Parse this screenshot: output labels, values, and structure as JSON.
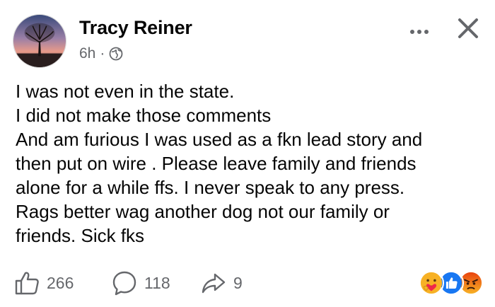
{
  "post": {
    "author": "Tracy Reiner",
    "time": "6h",
    "separator": "·",
    "privacy_icon": "globe-icon",
    "body_lines": [
      "I was not even in the state.",
      "I did not make those comments",
      "And am furious I was used as a fkn lead story and",
      "then put on wire . Please leave family and friends",
      "alone for a while ffs. I never speak to any press.",
      "Rags better wag another dog not our family or",
      "friends. Sick fks"
    ]
  },
  "actions": {
    "like_count": "266",
    "comment_count": "118",
    "share_count": "9"
  },
  "reactions": [
    "care-emoji-icon",
    "like-emoji-icon",
    "angry-emoji-icon"
  ],
  "colors": {
    "text": "#050505",
    "secondary": "#65676b",
    "like_blue": "#1877f2",
    "angry_red": "#e9710f",
    "care_yellow": "#f7b125"
  }
}
